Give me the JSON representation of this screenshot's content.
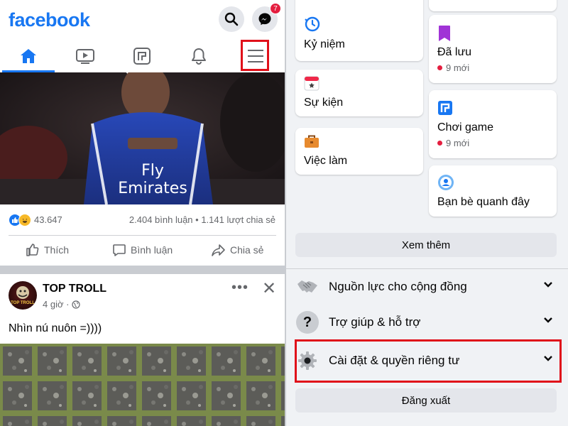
{
  "left": {
    "logo": "facebook",
    "messenger_badge": "7",
    "post_stats": {
      "reaction_count": "43.647",
      "comments_shares": "2.404 bình luận • 1.141 lượt chia sẻ"
    },
    "actions": {
      "like": "Thích",
      "comment": "Bình luận",
      "share": "Chia sẻ"
    },
    "post": {
      "author": "TOP TROLL",
      "avatar_text": "TOP TROLL",
      "time": "4 giờ ·",
      "more": "•••",
      "close": "✕",
      "text": "Nhìn nú nuôn =))))"
    },
    "video_jersey_text": "Fly\nEmirates"
  },
  "right": {
    "shortcuts_left": [
      {
        "label": "Kỷ niệm",
        "icon": "clock-icon"
      },
      {
        "label": "Sự kiện",
        "icon": "calendar-icon"
      },
      {
        "label": "Việc làm",
        "icon": "briefcase-icon"
      }
    ],
    "shortcuts_right": [
      {
        "label": "Đã lưu",
        "sub": "9 mới",
        "icon": "bookmark-icon"
      },
      {
        "label": "Chơi game",
        "sub": "9 mới",
        "icon": "game-icon"
      },
      {
        "label": "Bạn bè quanh đây",
        "icon": "nearby-friends-icon"
      }
    ],
    "see_more": "Xem thêm",
    "rows": [
      {
        "label": "Nguồn lực cho cộng đồng",
        "icon": "handshake-icon"
      },
      {
        "label": "Trợ giúp & hỗ trợ",
        "icon": "help-icon"
      },
      {
        "label": "Cài đặt & quyền riêng tư",
        "icon": "gear-icon"
      }
    ],
    "logout": "Đăng xuất"
  },
  "colors": {
    "brand": "#1877f2",
    "highlight": "#e0101a",
    "badge": "#e41e3f",
    "panel_bg": "#f0f2f5"
  }
}
